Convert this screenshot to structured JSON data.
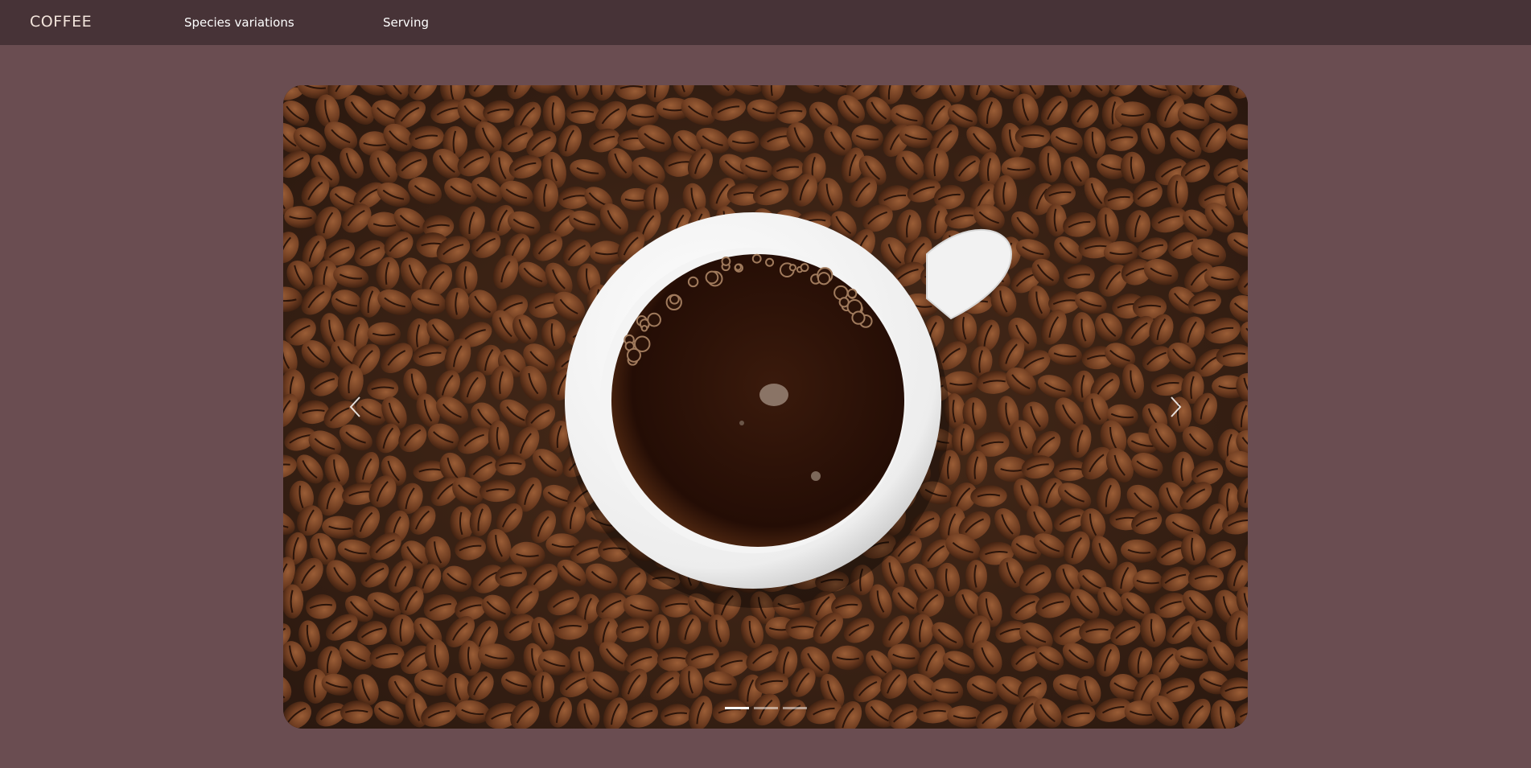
{
  "navbar": {
    "brand": "COFFEE",
    "links": [
      {
        "label": "Species variations"
      },
      {
        "label": "Serving"
      }
    ]
  },
  "carousel": {
    "slide_count": 3,
    "active_index": 0,
    "slide_subject": "cup of black coffee on coffee beans",
    "prev_icon": "chevron-left-icon",
    "next_icon": "chevron-right-icon"
  },
  "colors": {
    "page_background": "#6a4d51",
    "navbar_background": "#473337",
    "brand_text": "#f3e5dc"
  }
}
